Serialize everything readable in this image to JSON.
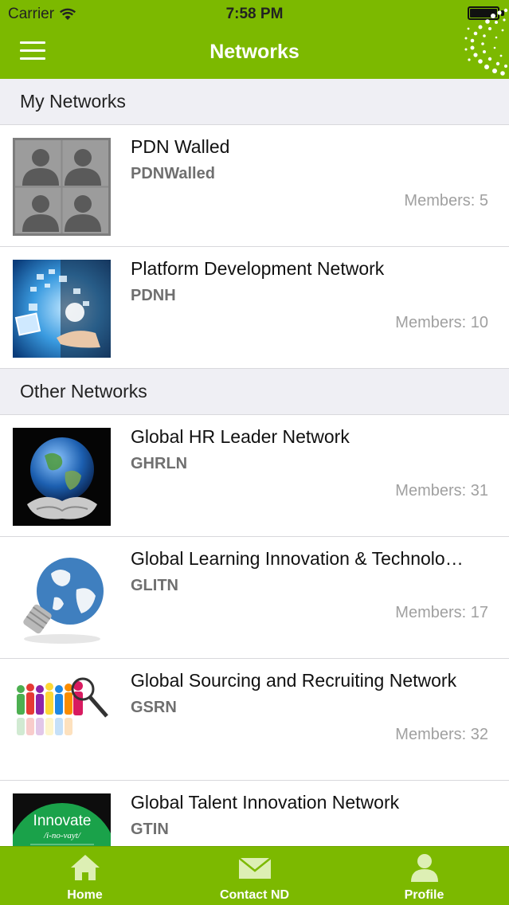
{
  "status_bar": {
    "carrier": "Carrier",
    "time": "7:58 PM"
  },
  "nav": {
    "title": "Networks"
  },
  "my_networks": {
    "header": "My Networks",
    "items": [
      {
        "name": "PDN Walled",
        "code": "PDNWalled",
        "members": "Members: 5",
        "thumb": "placeholder-group-image"
      },
      {
        "name": "Platform Development Network",
        "code": "PDNH",
        "members": "Members: 10",
        "thumb": "tech-hand-image"
      }
    ]
  },
  "other_networks": {
    "header": "Other Networks",
    "items": [
      {
        "name": "Global HR Leader Network",
        "code": "GHRLN",
        "members": "Members: 31",
        "thumb": "earth-in-hands-image"
      },
      {
        "name": "Global Learning Innovation & Technolo…",
        "code": "GLITN",
        "members": "Members: 17",
        "thumb": "globe-lightbulb-image"
      },
      {
        "name": "Global Sourcing and Recruiting Network",
        "code": "GSRN",
        "members": "Members: 32",
        "thumb": "people-magnifier-image"
      },
      {
        "name": "Global Talent Innovation Network",
        "code": "GTIN",
        "members": "",
        "thumb": "innovate-badge-image",
        "thumb_text": "Innovate",
        "thumb_subtext": "/i-no-vayt/"
      }
    ]
  },
  "tab_bar": {
    "home": "Home",
    "contact": "Contact ND",
    "profile": "Profile"
  },
  "colors": {
    "brand_green": "#7cb900",
    "section_bg": "#efeff4",
    "code_gray": "#6f6f6f",
    "members_gray": "#a0a0a0"
  }
}
